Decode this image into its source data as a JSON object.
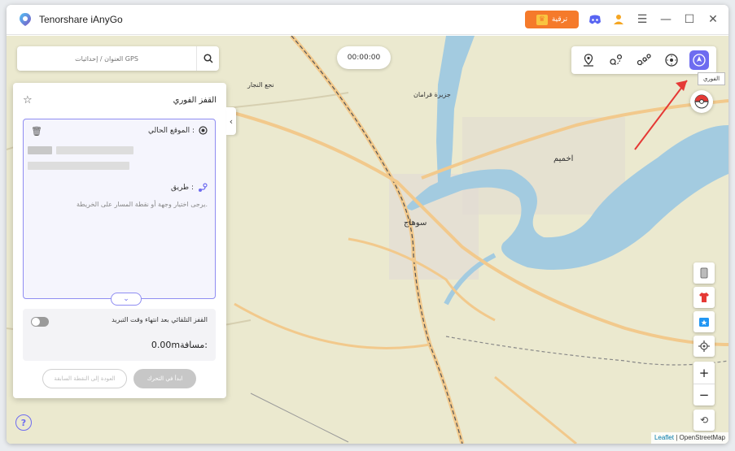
{
  "app": {
    "title": "Tenorshare iAnyGo"
  },
  "titlebar": {
    "upgrade_label": "ترقية"
  },
  "search": {
    "placeholder": "العنوان / إحداثيات GPS"
  },
  "timer": {
    "value": "00:00:00"
  },
  "toolbar": {
    "active_mode": "jump-teleport",
    "tooltip": "الفوري",
    "modes": [
      "teleport-icon",
      "two-spot-icon",
      "multi-spot-icon",
      "joystick-icon",
      "jump-teleport-icon"
    ]
  },
  "panel": {
    "title": "القفز الفوري",
    "current_location_label": "الموقع الحالي :",
    "route_label": "طريق :",
    "route_hint": "يرجى اختيار وجهة أو نقطة المسار على الخريطة.",
    "auto_jump_label": "القفز التلقائي بعد انتهاء وقت التبريد",
    "auto_jump_enabled": false,
    "distance_label": "مسافة:",
    "distance_value": "0.00m",
    "prev_point_button": "العودة إلى النقطة السابقة",
    "start_button": "ابدأ في التحرك"
  },
  "map": {
    "labels": {
      "sohag": "سوهاج",
      "akhmim": "اخميم",
      "island": "جزيرة قرامان",
      "najaa": "نجع النجار"
    },
    "attribution_leaflet": "Leaflet",
    "attribution_osm": "OpenStreetMap",
    "colors": {
      "land": "#ebe9cf",
      "river": "#a3cbe0",
      "road": "#f2c98c",
      "accent": "#6e6cf0"
    }
  },
  "help": {
    "label": "?"
  }
}
